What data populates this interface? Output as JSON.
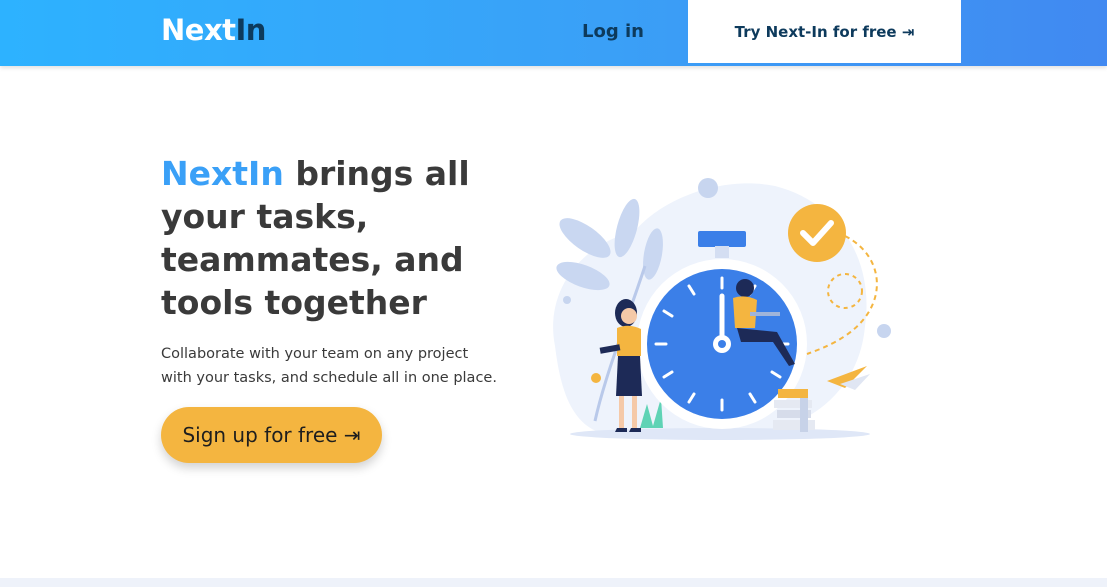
{
  "header": {
    "logo_part1": "Next",
    "logo_part2": "In",
    "login_label": "Log in",
    "try_label": "Try Next-In for free ⇥"
  },
  "hero": {
    "title_brand": "NextIn",
    "title_rest": " brings all your tasks, teammates, and tools together",
    "subtitle": "Collaborate with your team on any project with your tasks, and schedule all in one place.",
    "cta_label": "Sign up for free ⇥"
  },
  "colors": {
    "header_start": "#2db2ff",
    "header_end": "#4189f1",
    "brand_blue": "#3aa0f7",
    "dark_navy": "#0d3a5c",
    "cta_yellow": "#f4b540"
  },
  "illustration": {
    "icon": "clock-teamwork-illustration"
  }
}
